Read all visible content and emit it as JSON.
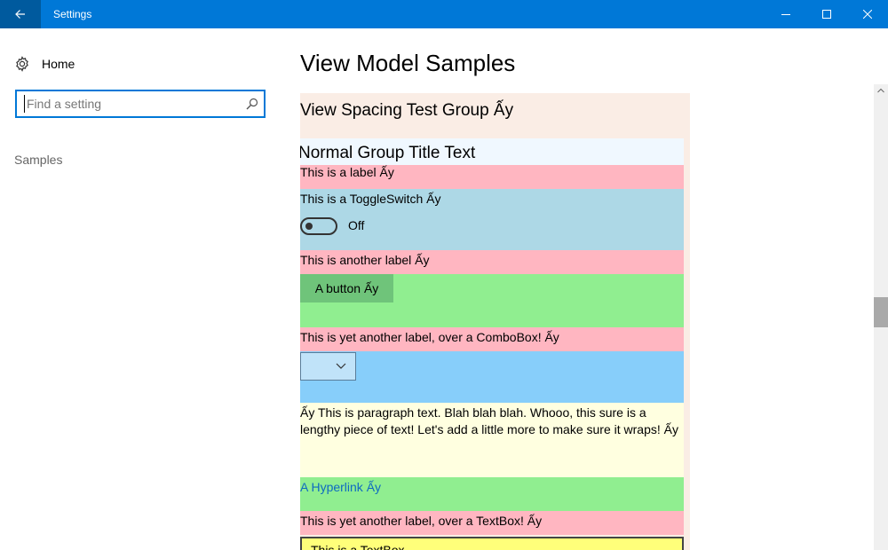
{
  "window": {
    "title": "Settings"
  },
  "sidebar": {
    "home_label": "Home",
    "search_placeholder": "Find a setting",
    "nav_item": "Samples"
  },
  "main": {
    "page_title": "View Model Samples",
    "group_title": "View Spacing Test Group Ấy",
    "normal_group_title": "Normal Group Title Text",
    "label1": "This is a label Ấy",
    "toggle_label": "This is a ToggleSwitch Ấy",
    "toggle_state": "Off",
    "label2": "This is another label Ấy",
    "button_label": "A button Ấy",
    "label3": "This is yet another label, over a ComboBox! Ấy",
    "paragraph": "Ấy This is paragraph text.  Blah blah blah.  Whooo, this sure is a lengthy piece of text!  Let's add a little more to make sure it wraps! Ấy",
    "hyperlink": "A Hyperlink Ấy",
    "label4": "This is yet another label, over a TextBox! Ấy",
    "textbox_value": "This is a TextBox"
  },
  "colors": {
    "accent": "#0078d7",
    "group_background": "#faede5",
    "normal_group_background": "#f0f8ff",
    "label_background": "#ffb6c1",
    "toggle_background": "#add8e6",
    "button_row_background": "#90ee90",
    "combo_row_background": "#87cefa",
    "paragraph_background": "#ffffe0",
    "textbox_background": "#ffff7a"
  }
}
